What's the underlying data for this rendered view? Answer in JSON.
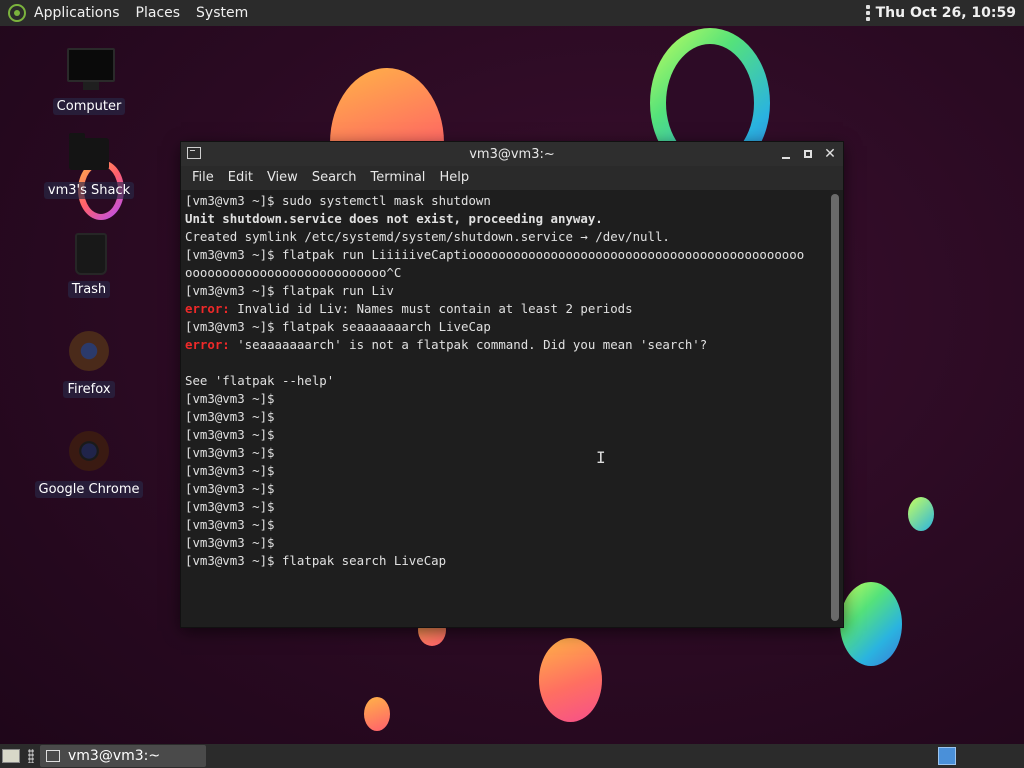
{
  "top_panel": {
    "menus": [
      "Applications",
      "Places",
      "System"
    ],
    "clock": "Thu Oct 26, 10:59"
  },
  "desktop_icons": [
    {
      "label": "Computer",
      "icon": "computer-icon"
    },
    {
      "label": "vm3's Shack",
      "icon": "home-folder-icon"
    },
    {
      "label": "Trash",
      "icon": "trash-icon"
    },
    {
      "label": "Firefox",
      "icon": "firefox-icon"
    },
    {
      "label": "Google Chrome",
      "icon": "chrome-icon"
    }
  ],
  "terminal": {
    "title": "vm3@vm3:~",
    "menu": [
      "File",
      "Edit",
      "View",
      "Search",
      "Terminal",
      "Help"
    ],
    "lines": [
      {
        "text": "[vm3@vm3 ~]$ sudo systemctl mask shutdown",
        "style": "normal"
      },
      {
        "text": "Unit shutdown.service does not exist, proceeding anyway.",
        "style": "bold"
      },
      {
        "text": "Created symlink /etc/systemd/system/shutdown.service → /dev/null.",
        "style": "normal"
      },
      {
        "text": "[vm3@vm3 ~]$ flatpak run LiiiiiveCaptiooooooooooooooooooooooooooooooooooooooooooooo",
        "style": "normal"
      },
      {
        "text": "ooooooooooooooooooooooooooo^C",
        "style": "normal"
      },
      {
        "text": "[vm3@vm3 ~]$ flatpak run Liv",
        "style": "normal"
      },
      {
        "prefix": "error:",
        "text": " Invalid id Liv: Names must contain at least 2 periods",
        "style": "error"
      },
      {
        "text": "[vm3@vm3 ~]$ flatpak seaaaaaaarch LiveCap",
        "style": "normal"
      },
      {
        "prefix": "error:",
        "text": " 'seaaaaaaarch' is not a flatpak command. Did you mean 'search'?",
        "style": "error"
      },
      {
        "text": "",
        "style": "normal"
      },
      {
        "text": "See 'flatpak --help'",
        "style": "normal"
      },
      {
        "text": "[vm3@vm3 ~]$",
        "style": "normal"
      },
      {
        "text": "[vm3@vm3 ~]$",
        "style": "normal"
      },
      {
        "text": "[vm3@vm3 ~]$",
        "style": "normal"
      },
      {
        "text": "[vm3@vm3 ~]$",
        "style": "normal"
      },
      {
        "text": "[vm3@vm3 ~]$",
        "style": "normal"
      },
      {
        "text": "[vm3@vm3 ~]$",
        "style": "normal"
      },
      {
        "text": "[vm3@vm3 ~]$",
        "style": "normal"
      },
      {
        "text": "[vm3@vm3 ~]$",
        "style": "normal"
      },
      {
        "text": "[vm3@vm3 ~]$",
        "style": "normal"
      },
      {
        "text": "[vm3@vm3 ~]$ flatpak search LiveCap",
        "style": "normal"
      }
    ]
  },
  "bottom_panel": {
    "task_label": "vm3@vm3:~"
  },
  "colors": {
    "error": "#ef2929",
    "panel": "#2b2b2b",
    "workspace_active": "#4a90d9"
  }
}
